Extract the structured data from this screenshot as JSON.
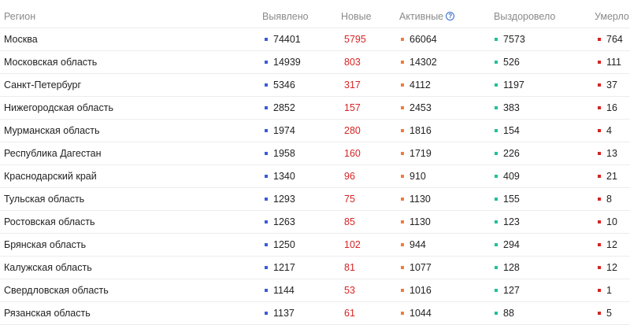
{
  "columns": {
    "region": "Регион",
    "detected": "Выявлено",
    "new": "Новые",
    "active": "Активные",
    "active_help_icon": "question-circle-icon",
    "active_help_glyph": "?",
    "recovered": "Выздоровело",
    "deaths": "Умерло"
  },
  "colors": {
    "detected": "#3b5bdb",
    "new": "#d62424",
    "active": "#f07b3f",
    "recovered": "#20c09a",
    "deaths": "#d62424"
  },
  "rows": [
    {
      "region": "Москва",
      "detected": "74401",
      "new": "5795",
      "active": "66064",
      "recovered": "7573",
      "deaths": "764"
    },
    {
      "region": "Московская область",
      "detected": "14939",
      "new": "803",
      "active": "14302",
      "recovered": "526",
      "deaths": "111"
    },
    {
      "region": "Санкт-Петербург",
      "detected": "5346",
      "new": "317",
      "active": "4112",
      "recovered": "1197",
      "deaths": "37"
    },
    {
      "region": "Нижегородская область",
      "detected": "2852",
      "new": "157",
      "active": "2453",
      "recovered": "383",
      "deaths": "16"
    },
    {
      "region": "Мурманская область",
      "detected": "1974",
      "new": "280",
      "active": "1816",
      "recovered": "154",
      "deaths": "4"
    },
    {
      "region": "Республика Дагестан",
      "detected": "1958",
      "new": "160",
      "active": "1719",
      "recovered": "226",
      "deaths": "13"
    },
    {
      "region": "Краснодарский край",
      "detected": "1340",
      "new": "96",
      "active": "910",
      "recovered": "409",
      "deaths": "21"
    },
    {
      "region": "Тульская область",
      "detected": "1293",
      "new": "75",
      "active": "1130",
      "recovered": "155",
      "deaths": "8"
    },
    {
      "region": "Ростовская область",
      "detected": "1263",
      "new": "85",
      "active": "1130",
      "recovered": "123",
      "deaths": "10"
    },
    {
      "region": "Брянская область",
      "detected": "1250",
      "new": "102",
      "active": "944",
      "recovered": "294",
      "deaths": "12"
    },
    {
      "region": "Калужская область",
      "detected": "1217",
      "new": "81",
      "active": "1077",
      "recovered": "128",
      "deaths": "12"
    },
    {
      "region": "Свердловская область",
      "detected": "1144",
      "new": "53",
      "active": "1016",
      "recovered": "127",
      "deaths": "1"
    },
    {
      "region": "Рязанская область",
      "detected": "1137",
      "new": "61",
      "active": "1044",
      "recovered": "88",
      "deaths": "5"
    }
  ]
}
